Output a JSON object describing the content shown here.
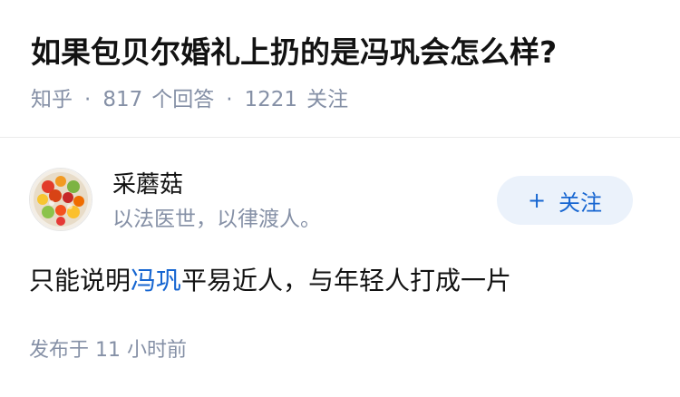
{
  "question": {
    "title": "如果包贝尔婚礼上扔的是冯巩会怎么样?",
    "source": "知乎",
    "answer_count": "817",
    "answer_label": "个回答",
    "follower_count": "1221",
    "follower_label": "关注"
  },
  "answer": {
    "author": {
      "name": "采蘑菇",
      "bio": "以法医世，以律渡人。",
      "avatar_icon": "food-platter-avatar"
    },
    "follow_button": {
      "icon": "plus-icon",
      "label": "关注"
    },
    "content": {
      "before": "只能说明",
      "link": "冯巩",
      "after": "平易近人，与年轻人打成一片"
    },
    "time": "发布于 11 小时前"
  },
  "colors": {
    "accent": "#1766d1",
    "muted": "#8590a6",
    "button_bg": "#ebf2fb"
  }
}
